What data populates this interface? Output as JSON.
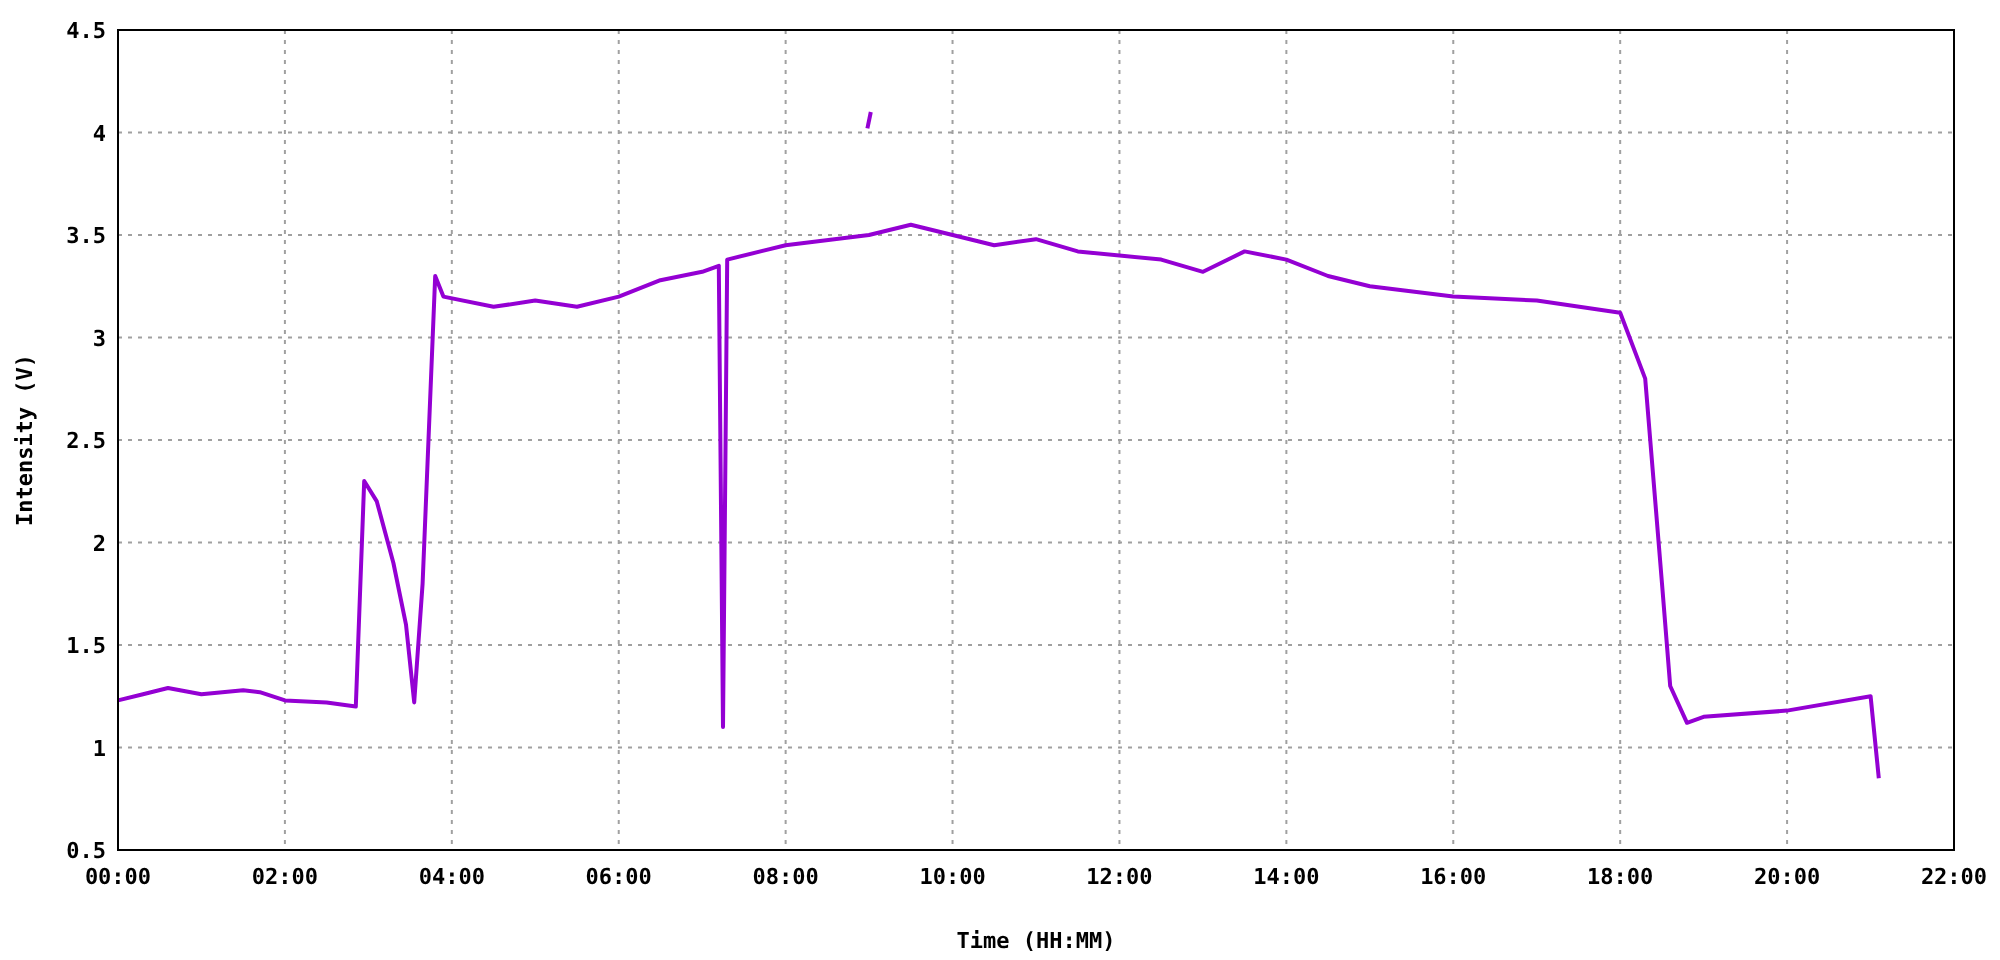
{
  "chart_data": {
    "type": "line",
    "xlabel": "Time (HH:MM)",
    "ylabel": "Intensity (V)",
    "xlim": [
      0,
      22
    ],
    "ylim": [
      0.5,
      4.5
    ],
    "grid": true,
    "xticks": [
      {
        "value": 0,
        "label": "00:00"
      },
      {
        "value": 2,
        "label": "02:00"
      },
      {
        "value": 4,
        "label": "04:00"
      },
      {
        "value": 6,
        "label": "06:00"
      },
      {
        "value": 8,
        "label": "08:00"
      },
      {
        "value": 10,
        "label": "10:00"
      },
      {
        "value": 12,
        "label": "12:00"
      },
      {
        "value": 14,
        "label": "14:00"
      },
      {
        "value": 16,
        "label": "16:00"
      },
      {
        "value": 18,
        "label": "18:00"
      },
      {
        "value": 20,
        "label": "20:00"
      },
      {
        "value": 22,
        "label": "22:00"
      }
    ],
    "yticks": [
      {
        "value": 0.5,
        "label": "0.5"
      },
      {
        "value": 1,
        "label": "1"
      },
      {
        "value": 1.5,
        "label": "1.5"
      },
      {
        "value": 2,
        "label": "2"
      },
      {
        "value": 2.5,
        "label": "2.5"
      },
      {
        "value": 3,
        "label": "3"
      },
      {
        "value": 3.5,
        "label": "3.5"
      },
      {
        "value": 4,
        "label": "4"
      },
      {
        "value": 4.5,
        "label": "4.5"
      }
    ],
    "series": [
      {
        "color": "#9400d3",
        "x": [
          0,
          0.3,
          0.6,
          1.0,
          1.5,
          1.7,
          2.0,
          2.5,
          2.85,
          2.95,
          3.1,
          3.3,
          3.45,
          3.55,
          3.65,
          3.8,
          3.9,
          4.5,
          5.0,
          5.5,
          6.0,
          6.5,
          7.0,
          7.2,
          7.25,
          7.3,
          8,
          9,
          9.5,
          10,
          10.5,
          11,
          11.5,
          12,
          12.5,
          13,
          13.5,
          14,
          14.5,
          15,
          16,
          17,
          18,
          18.3,
          18.5,
          18.6,
          18.8,
          19,
          20,
          21,
          21.1
        ],
        "values": [
          1.23,
          1.26,
          1.29,
          1.26,
          1.28,
          1.27,
          1.23,
          1.22,
          1.2,
          2.3,
          2.2,
          1.9,
          1.6,
          1.22,
          1.8,
          3.3,
          3.2,
          3.15,
          3.18,
          3.15,
          3.2,
          3.28,
          3.32,
          3.35,
          1.1,
          3.38,
          3.45,
          3.5,
          3.55,
          3.5,
          3.45,
          3.48,
          3.42,
          3.4,
          3.38,
          3.32,
          3.42,
          3.38,
          3.3,
          3.25,
          3.2,
          3.18,
          3.12,
          2.8,
          1.8,
          1.3,
          1.12,
          1.15,
          1.18,
          1.25,
          0.85
        ]
      },
      {
        "color": "#9400d3",
        "x": [
          8.98,
          9.02
        ],
        "values": [
          4.02,
          4.1
        ]
      }
    ]
  }
}
